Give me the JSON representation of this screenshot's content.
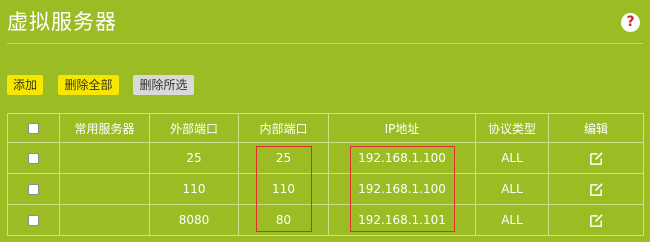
{
  "page": {
    "title": "虚拟服务器",
    "help_label": "?"
  },
  "toolbar": {
    "add_label": "添加",
    "delete_all_label": "删除全部",
    "delete_selected_label": "删除所选"
  },
  "table": {
    "headers": [
      "",
      "常用服务器",
      "外部端口",
      "内部端口",
      "IP地址",
      "协议类型",
      "编辑"
    ],
    "rows": [
      {
        "service": "",
        "external_port": "25",
        "internal_port": "25",
        "ip": "192.168.1.100",
        "protocol": "ALL"
      },
      {
        "service": "",
        "external_port": "110",
        "internal_port": "110",
        "ip": "192.168.1.100",
        "protocol": "ALL"
      },
      {
        "service": "",
        "external_port": "8080",
        "internal_port": "80",
        "ip": "192.168.1.101",
        "protocol": "ALL"
      }
    ]
  },
  "icons": {
    "help": "help-icon",
    "edit": "edit-icon",
    "checkbox": "checkbox"
  },
  "colors": {
    "background": "#9cbc24",
    "primary_button": "#f6e600",
    "secondary_button": "#d9d9d9",
    "highlight_box": "#e03030",
    "help_mark": "#d02828"
  }
}
